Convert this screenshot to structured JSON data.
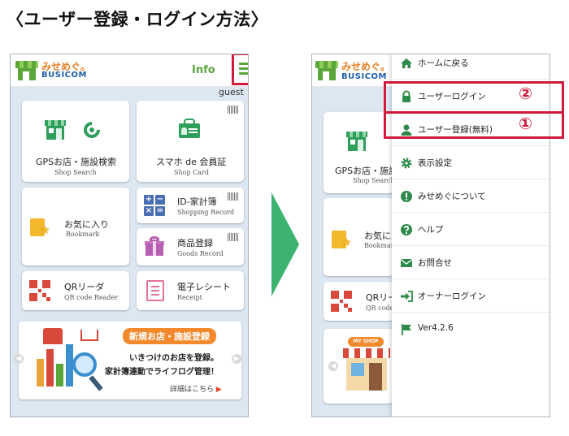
{
  "page_title": "〈ユーザー登録・ログイン方法〉",
  "app": {
    "logo_line1": "みせめぐ。",
    "logo_line2": "BUSICOM",
    "info_label": "Info",
    "guest_label": "guest"
  },
  "tiles": [
    {
      "title": "GPSお店・施設検索",
      "sub": "Shop Search"
    },
    {
      "title": "スマホ de 会員証",
      "sub": "Shop Card"
    },
    {
      "title": "お気に入り",
      "sub": "Bookmark"
    },
    {
      "title": "ID-家計簿",
      "sub": "Shopping Record"
    },
    {
      "title": "商品登録",
      "sub": "Goods Record"
    },
    {
      "title": "QRリーダ",
      "sub": "QR code Reader"
    },
    {
      "title": "電子レシート",
      "sub": "Receipt"
    }
  ],
  "banner": {
    "tag": "新規お店・施設登録",
    "line1": "いきつけのお店を登録。",
    "line2": "家計簿連動でライフログ管理！",
    "more": "詳細はこちら",
    "more_arrow": "▶",
    "shop_sign": "MY SHOP"
  },
  "background_tiles": {
    "gps_title": "GPSお店・施設",
    "gps_sub": "Shop Search",
    "bookmark_title": "お気に入",
    "bookmark_sub": "Bookmark",
    "qr_title": "QRリー",
    "qr_sub": "QR code Re"
  },
  "drawer": {
    "items": [
      {
        "label": "ホームに戻る",
        "icon": "home-icon"
      },
      {
        "label": "ユーザーログイン",
        "icon": "lock-icon"
      },
      {
        "label": "ユーザー登録(無料)",
        "icon": "user-icon"
      },
      {
        "label": "表示設定",
        "icon": "gear-icon"
      },
      {
        "label": "みせめぐについて",
        "icon": "info-icon"
      },
      {
        "label": "ヘルプ",
        "icon": "help-icon"
      },
      {
        "label": "お問合せ",
        "icon": "mail-icon"
      },
      {
        "label": "オーナーログイン",
        "icon": "login-icon"
      },
      {
        "label": "Ver4.2.6",
        "icon": "flag-icon"
      }
    ]
  },
  "callouts": {
    "login_number": "②",
    "register_number": "①"
  },
  "colors": {
    "accent_green": "#5aa63a",
    "highlight_red": "#d11a3a",
    "icon_green": "#2e9e5b"
  }
}
